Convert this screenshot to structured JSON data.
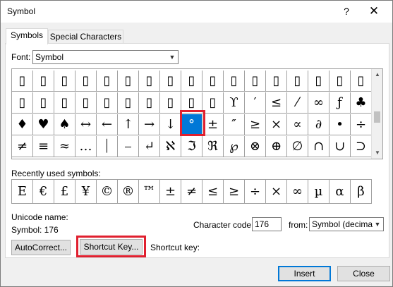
{
  "window": {
    "title": "Symbol",
    "help": "?",
    "close": "✕"
  },
  "tabs": [
    {
      "label": "Symbols",
      "active": true
    },
    {
      "label": "Special Characters",
      "active": false
    }
  ],
  "font": {
    "label": "Font:",
    "value": "Symbol"
  },
  "grid": {
    "rows": [
      [
        "▯",
        "▯",
        "▯",
        "▯",
        "▯",
        "▯",
        "▯",
        "▯",
        "▯",
        "▯",
        "▯",
        "▯",
        "▯",
        "▯",
        "▯",
        "▯",
        "▯"
      ],
      [
        "▯",
        "▯",
        "▯",
        "▯",
        "▯",
        "▯",
        "▯",
        "▯",
        "▯",
        "▯",
        "ϒ",
        "′",
        "≤",
        "⁄",
        "∞",
        "ƒ",
        "♣"
      ],
      [
        "♦",
        "♥",
        "♠",
        "↔",
        "←",
        "↑",
        "→",
        "↓",
        "°",
        "±",
        "″",
        "≥",
        "×",
        "∝",
        "∂",
        "•",
        "÷"
      ],
      [
        "≠",
        "≡",
        "≈",
        "…",
        "⏐",
        "⎯",
        "↵",
        "ℵ",
        "ℑ",
        "ℜ",
        "℘",
        "⊗",
        "⊕",
        "∅",
        "∩",
        "∪",
        "⊃"
      ]
    ],
    "selected_row": 2,
    "selected_col": 8
  },
  "recent": {
    "label": "Recently used symbols:",
    "symbols": [
      "E",
      "€",
      "£",
      "¥",
      "©",
      "®",
      "™",
      "±",
      "≠",
      "≤",
      "≥",
      "÷",
      "×",
      "∞",
      "µ",
      "α",
      "β"
    ]
  },
  "unicode_name_label": "Unicode name:",
  "symbol_code_text": "Symbol: 176",
  "character_code": {
    "label": "Character code:",
    "value": "176"
  },
  "from": {
    "label": "from:",
    "value": "Symbol (decimal)"
  },
  "buttons": {
    "autocorrect": "AutoCorrect...",
    "shortcut_key": "Shortcut Key...",
    "insert": "Insert",
    "close": "Close"
  },
  "shortcut_key_label": "Shortcut key:",
  "colors": {
    "selection": "#0078d7",
    "highlight_box": "#e0202f"
  }
}
